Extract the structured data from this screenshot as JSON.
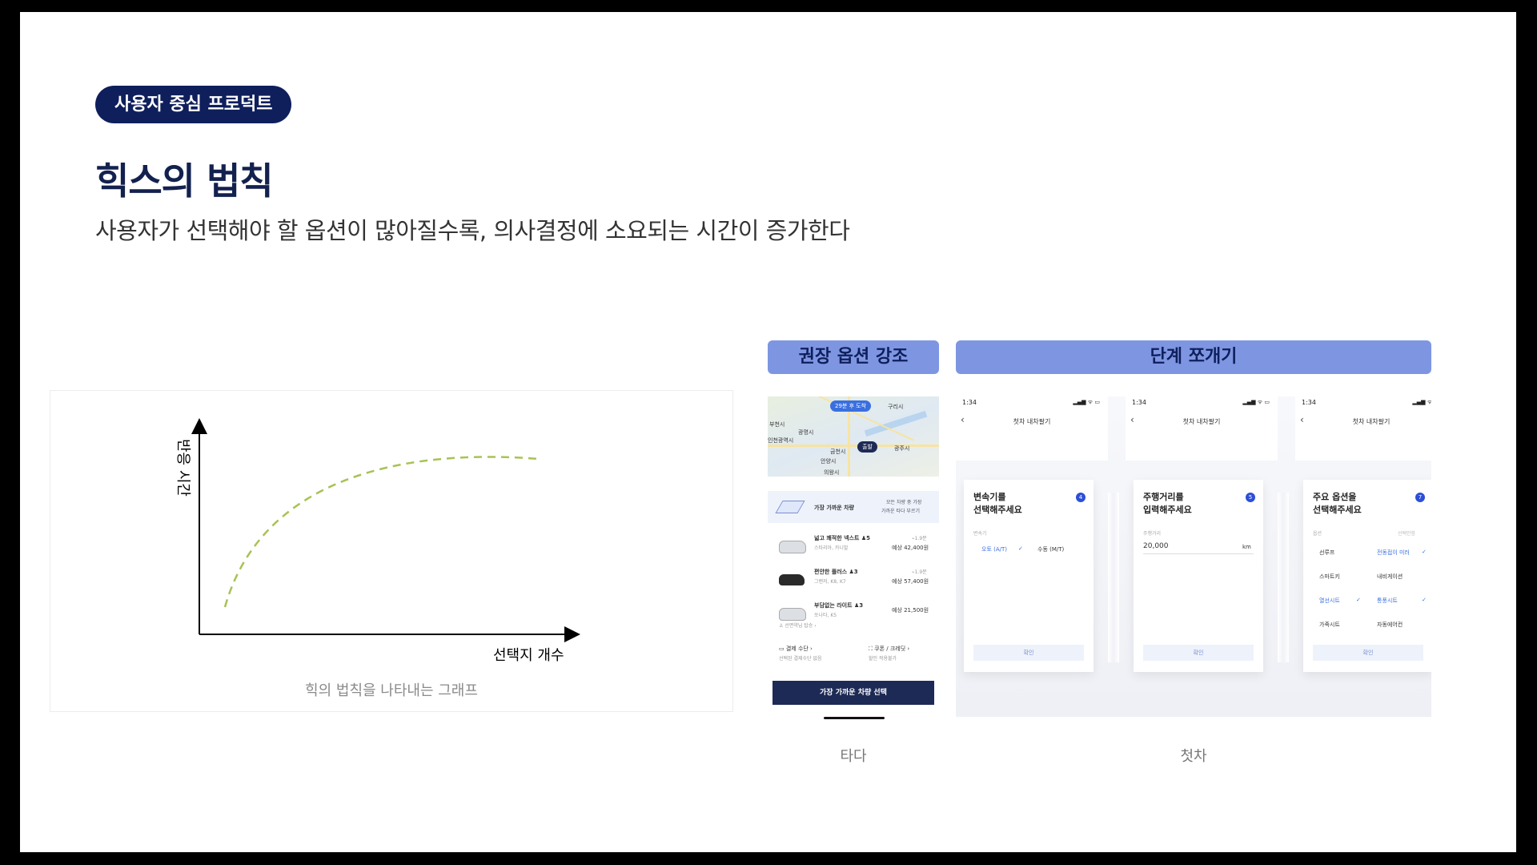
{
  "header": {
    "pill": "사용자 중심 프로덕트",
    "title": "힉스의 법칙",
    "subtitle": "사용자가 선택해야 할 옵션이 많아질수록, 의사결정에 소요되는 시간이 증가한다"
  },
  "graph": {
    "y_label": "반응 시간",
    "x_label": "선택지 개수",
    "caption": "힉의 법칙을 나타내는 그래프",
    "curve_color": "#a8c256"
  },
  "examples": {
    "tag1": "권장 옵션 강조",
    "tag2": "단계 쪼개기",
    "caption1": "타다",
    "caption2": "첫차"
  },
  "tada": {
    "map_pin_top": "29분 후 도착",
    "map_pin_start": "출발",
    "map_labels": [
      "구리시",
      "부천시",
      "광명시",
      "인천광역시",
      "금천시",
      "광주시",
      "안양시",
      "의왕시"
    ],
    "nearest_label": "가장 가까운 차량",
    "nearest_note1": "모든 차량 중 가장",
    "nearest_note2": "가까운 타다 부르기",
    "cars": [
      {
        "name": "넓고 쾌적한 넥스트 ♟5",
        "sub": "스타리아, 카니발",
        "price": "예상 42,400원",
        "eta": "⌁1.9분"
      },
      {
        "name": "편안한 플러스 ♟3",
        "sub": "그랜저, K8, K7",
        "price": "예상 57,400원",
        "eta": "⌁1.9분"
      },
      {
        "name": "부담없는 라이트 ♟3",
        "sub": "쏘나타, K5",
        "price": "예상 21,500원",
        "eta": ""
      }
    ],
    "guide": "♙ 선면약님 탑승 ›",
    "payment": "▭ 결제 수단 ›",
    "payment_sub": "선택된 결제수단 없음",
    "coupon": "⛶ 쿠폰 / 크레딧 ›",
    "coupon_sub": "할인 적용불가",
    "button": "가장 가까운 차량 선택"
  },
  "chatcha": {
    "time": "1:34",
    "signal": "▂▄▆ ᯤ ▭",
    "back": "‹",
    "screen_title": "첫차 내차팔기",
    "cards": [
      {
        "question": "변속기를\n선택해주세요",
        "badge": "4",
        "label": "변속기",
        "opt1": "오토 (A/T)",
        "check1": "✓",
        "opt2": "수동 (M/T)",
        "button": "확인"
      },
      {
        "question": "주행거리를\n입력해주세요",
        "badge": "5",
        "label": "주행거리",
        "value": "20,000",
        "unit": "km",
        "button": "확인"
      },
      {
        "question": "주요 옵션을\n선택해주세요",
        "badge": "7",
        "label": "옵션",
        "right_hint": "선택안함",
        "rows": [
          {
            "left": "선루프",
            "right": "전동접이 미러",
            "check": "✓"
          },
          {
            "left": "스마트키",
            "right": "내비게이션",
            "check": ""
          },
          {
            "left": "열선시트",
            "right": "통풍시트",
            "check": "✓"
          },
          {
            "left": "가죽시트",
            "right": "자동에어컨",
            "check": ""
          }
        ],
        "button": "확인"
      }
    ]
  }
}
